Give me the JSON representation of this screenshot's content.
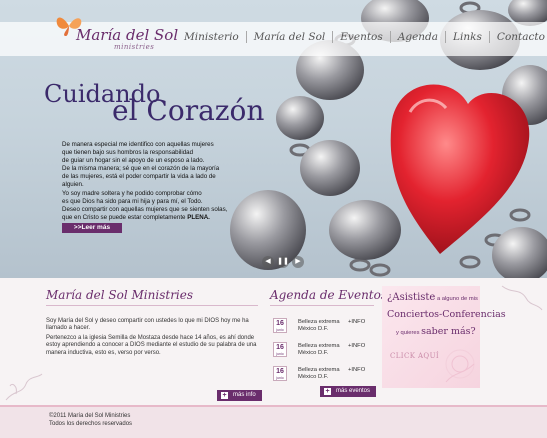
{
  "brand": {
    "name": "María del Sol",
    "subtitle": "ministries"
  },
  "nav": {
    "items": [
      "Ministerio",
      "María del Sol",
      "Eventos",
      "Agenda",
      "Links",
      "Contacto"
    ]
  },
  "hero": {
    "title_line1": "Cuidando",
    "title_line2": "el Corazón",
    "paragraph": [
      "De manera especial me identifico con aquellas mujeres",
      "que tienen bajo sus hombros la responsabilidad",
      "de guiar un hogar sin el apoyo de un esposo a lado.",
      "De la misma manera; sé que en el corazón de la mayoría",
      "de las mujeres, está el poder compartir la vida a lado de",
      "alguien.",
      "Yo soy madre soltera y he podido comprobar cómo",
      "es que Dios ha sido para mi hija y para mí, el Todo.",
      "Deseo compartir con aquellas mujeres que se sienten solas,"
    ],
    "paragraph_last_prefix": "que en Cristo se puede estar completamente ",
    "paragraph_last_strong": "PLENA.",
    "read_more": ">>Leer más",
    "slider": {
      "prev": "◀",
      "pause": "❚❚",
      "next": "▶"
    }
  },
  "about": {
    "title": "María del Sol Ministries",
    "p1": "Soy María del Sol y deseo compartir con ustedes lo que mi DIOS hoy me ha llamado a hacer.",
    "p2": "Pertenezco a la iglesia Semilla de Mostaza desde hace 14 años, es ahí donde estoy aprendiendo a conocer a DIOS mediante el estudio de su palabra de una manera inductiva, esto es, verso por verso.",
    "more_button": "más info"
  },
  "agenda": {
    "title": "Agenda de Eventos",
    "events": [
      {
        "day": "16",
        "month": "junio",
        "title": "Belleza extrema México D.F.",
        "info": "+INFO"
      },
      {
        "day": "16",
        "month": "junio",
        "title": "Belleza extrema México D.F.",
        "info": "+INFO"
      },
      {
        "day": "16",
        "month": "junio",
        "title": "Belleza extrema México D.F.",
        "info": "+INFO"
      }
    ],
    "more_button": "más eventos"
  },
  "promo": {
    "line1_big": "¿Asististe",
    "line1_small": " a alguno de mis",
    "line2": "Conciertos-Conferencias",
    "line3_small": "y quieres ",
    "line3_big": "saber más?",
    "cta": "CLICK AQUÍ"
  },
  "footer": {
    "line1": "©2011 María del Sol Ministries",
    "line2": "Todos los derechos reservados"
  },
  "colors": {
    "brand_purple": "#6a2d6c",
    "accent_pink": "#e7b9c9",
    "heart_red": "#e3232f"
  }
}
